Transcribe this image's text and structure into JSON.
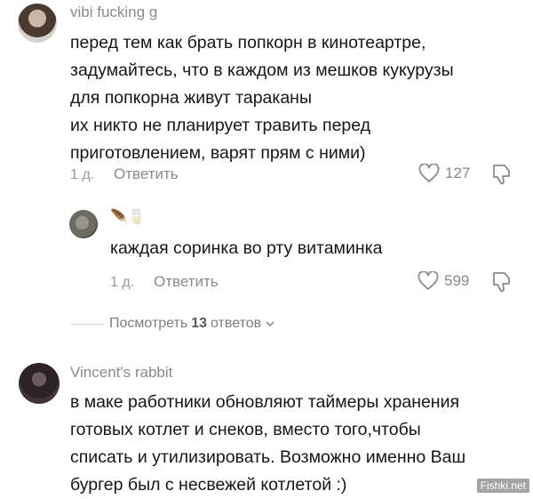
{
  "comments": [
    {
      "author": "vibi fucking g",
      "text": "перед тем как брать попкорн в кинотеартре,\nзадумайтесь, что в каждом из мешков кукурузы\nдля попкорна живут тараканы\nих никто не планирует травить перед\nприготовлением, варят прям с ними)",
      "age": "1 д.",
      "reply_label": "Ответить",
      "likes": "127"
    },
    {
      "author_emoji": "🪶🥛",
      "text": "каждая соринка во рту витаминка",
      "age": "1 д.",
      "reply_label": "Ответить",
      "likes": "599"
    },
    {
      "author": "Vincent's rabbit",
      "text": "в маке работники обновляют таймеры хранения\nготовых котлет и снеков, вместо того,чтобы\nсписать и утилизировать. Возможно именно Ваш\nбургер был с несвежей котлетой :)"
    }
  ],
  "view_replies": {
    "prefix": "Посмотреть",
    "count": "13",
    "suffix": "ответов"
  },
  "watermark": "Fishki.net"
}
